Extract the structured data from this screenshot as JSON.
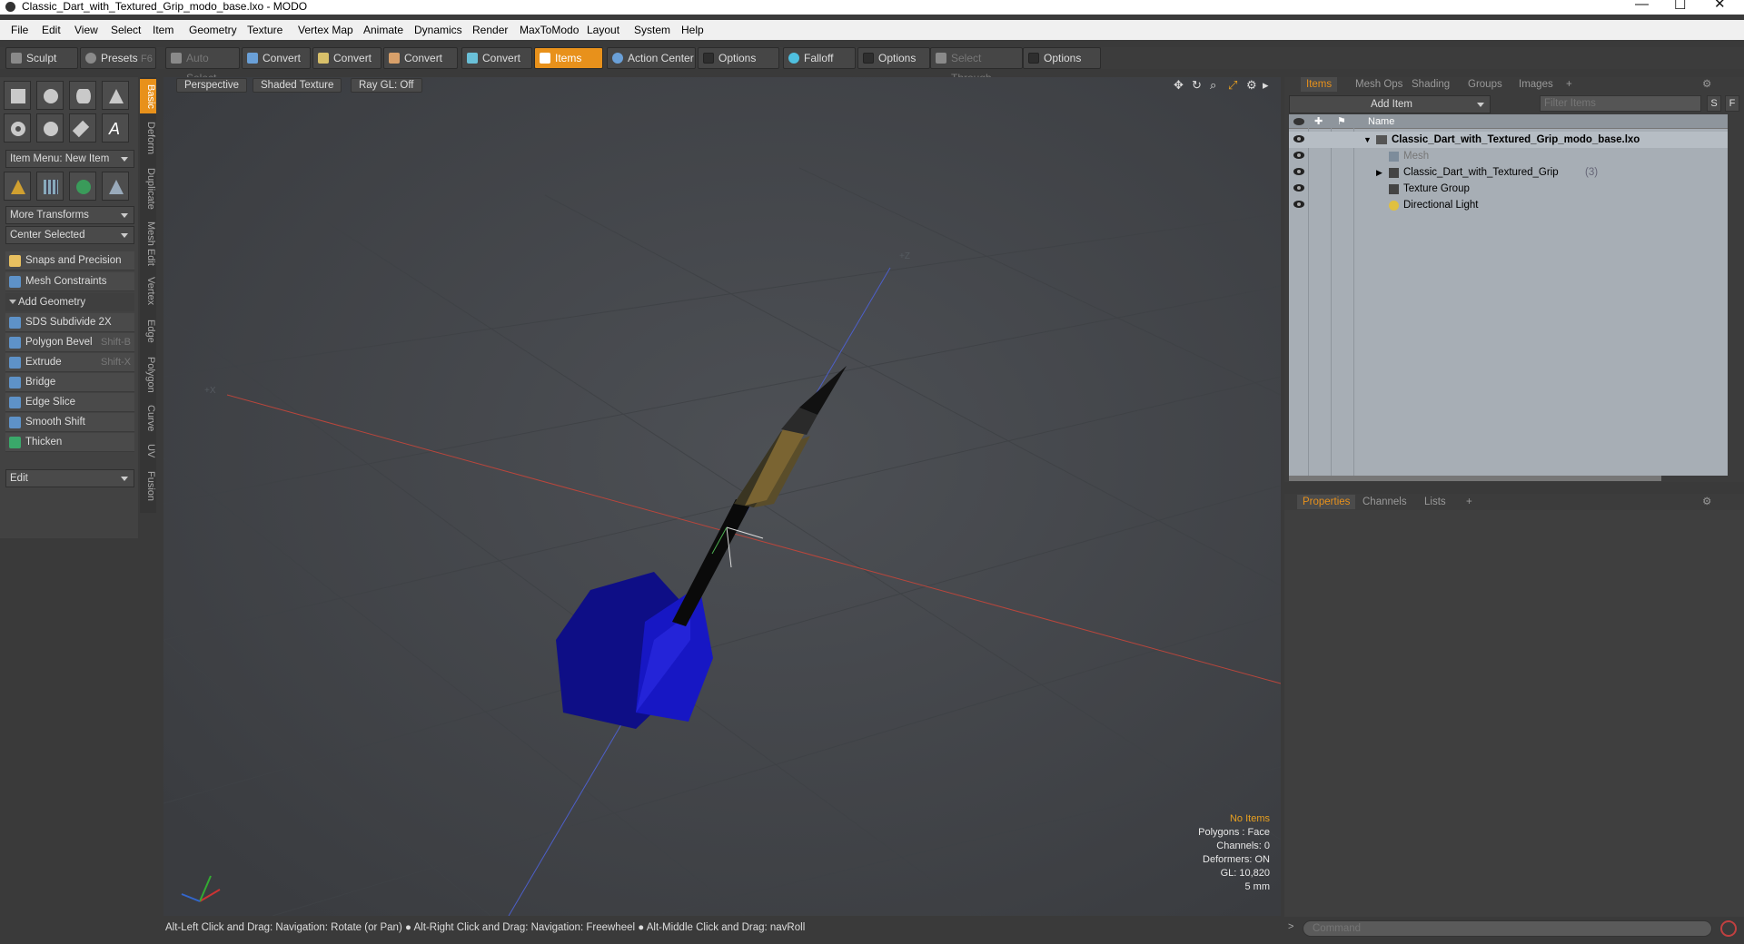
{
  "window": {
    "title": "Classic_Dart_with_Textured_Grip_modo_base.lxo - MODO",
    "controls": [
      "minimize",
      "maximize",
      "close"
    ]
  },
  "menu": [
    "File",
    "Edit",
    "View",
    "Select",
    "Item",
    "Geometry",
    "Texture",
    "Vertex Map",
    "Animate",
    "Dynamics",
    "Render",
    "MaxToModo",
    "Layout",
    "System",
    "Help"
  ],
  "toolbar": {
    "sculpt": "Sculpt",
    "presets": "Presets",
    "presets_shortcut": "F6",
    "auto_select": "Auto Select",
    "convert1": "Convert",
    "convert2": "Convert",
    "convert3": "Convert",
    "convert4": "Convert",
    "items": "Items",
    "action_center": "Action Center",
    "options1": "Options",
    "falloff": "Falloff",
    "options2": "Options",
    "select_through": "Select Through",
    "options3": "Options"
  },
  "left_panel": {
    "item_menu": "Item Menu: New Item",
    "more_transforms": "More Transforms",
    "center_selected": "Center Selected",
    "snaps": "Snaps and Precision",
    "mesh_constraints": "Mesh Constraints",
    "add_geometry": "Add Geometry",
    "tools": [
      {
        "label": "SDS Subdivide 2X",
        "shortcut": ""
      },
      {
        "label": "Polygon Bevel",
        "shortcut": "Shift-B"
      },
      {
        "label": "Extrude",
        "shortcut": "Shift-X"
      },
      {
        "label": "Bridge",
        "shortcut": ""
      },
      {
        "label": "Edge Slice",
        "shortcut": ""
      },
      {
        "label": "Smooth Shift",
        "shortcut": ""
      },
      {
        "label": "Thicken",
        "shortcut": ""
      }
    ],
    "edit": "Edit",
    "vtabs": [
      "Basic",
      "Deform",
      "Duplicate",
      "Mesh Edit",
      "Vertex",
      "Edge",
      "Polygon",
      "Curve",
      "UV",
      "Fusion"
    ]
  },
  "viewport": {
    "view": "Perspective",
    "shading": "Shaded Texture",
    "raygl": "Ray GL: Off",
    "info": {
      "selection": "No Items",
      "polygons": "Polygons : Face",
      "channels": "Channels: 0",
      "deformers": "Deformers: ON",
      "gl": "GL: 10,820",
      "scale": "5 mm"
    }
  },
  "status_bar": {
    "hint1": "Alt-Left Click and Drag: Navigation: Rotate (or Pan)",
    "hint2": "Alt-Right Click and Drag: Navigation: Freewheel",
    "hint3": "Alt-Middle Click and Drag: navRoll"
  },
  "items_panel": {
    "tabs": [
      "Items",
      "Mesh Ops",
      "Shading",
      "Groups",
      "Images"
    ],
    "add_item": "Add Item",
    "filter_placeholder": "Filter Items",
    "s_btn": "S",
    "f_btn": "F",
    "name_header": "Name",
    "items": [
      {
        "name": "Classic_Dart_with_Textured_Grip_modo_base.lxo",
        "suffix": ""
      },
      {
        "name": "Mesh",
        "suffix": ""
      },
      {
        "name": "Classic_Dart_with_Textured_Grip",
        "suffix": "(3)"
      },
      {
        "name": "Texture Group",
        "suffix": ""
      },
      {
        "name": "Directional Light",
        "suffix": ""
      }
    ]
  },
  "properties_panel": {
    "tabs": [
      "Properties",
      "Channels",
      "Lists"
    ]
  },
  "command": {
    "placeholder": "Command"
  },
  "colors": {
    "accent": "#e8911b",
    "viewport_bg": "#46494d",
    "dart_flight": "#10108a",
    "item_list_bg": "#a7aeb5"
  }
}
